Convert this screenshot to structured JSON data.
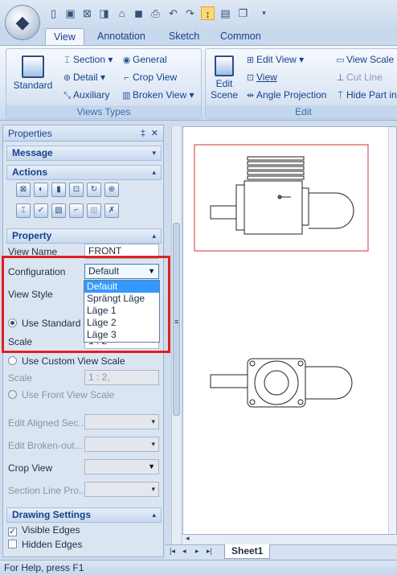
{
  "qat": {
    "icons": [
      "new-icon",
      "open-icon",
      "export-icon",
      "print-preview-icon",
      "folder-icon",
      "save-icon",
      "print-icon",
      "undo-icon",
      "redo-icon",
      "smart-dimension-icon",
      "notes-icon",
      "window-icon",
      "customize-icon"
    ]
  },
  "tabs": [
    {
      "label": "View",
      "active": true
    },
    {
      "label": "Annotation"
    },
    {
      "label": "Sketch"
    },
    {
      "label": "Common"
    }
  ],
  "ribbon": {
    "views_types": {
      "label": "Views Types",
      "standard": "Standard",
      "section": "Section",
      "detail": "Detail",
      "auxiliary": "Auxiliary",
      "general": "General",
      "crop_view": "Crop View",
      "broken_view": "Broken View"
    },
    "edit": {
      "label": "Edit",
      "edit_scene": "Edit Scene",
      "edit_view": "Edit View",
      "view": "View",
      "angle_projection": "Angle Projection",
      "view_scale": "View Scale",
      "cut_line": "Cut Line",
      "hide_part": "Hide Part in"
    }
  },
  "panel": {
    "title": "Properties",
    "pin": "‡",
    "close": "✕",
    "sections": {
      "message": "Message",
      "actions": "Actions",
      "property": "Property",
      "drawing_settings": "Drawing Settings"
    },
    "view_name_label": "View Name",
    "view_name_value": "FRONT",
    "configuration_label": "Configuration",
    "configuration_value": "Default",
    "configuration_options": [
      "Default",
      "Sprängt Läge",
      "Läge 1",
      "Läge 2",
      "Läge 3"
    ],
    "view_style_label": "View Style",
    "use_standard_label": "Use Standard V",
    "scale_label": "Scale",
    "scale_value": "1 : 2",
    "use_custom_label": "Use Custom View Scale",
    "scale2_label": "Scale",
    "scale2_value": "1 : 2,",
    "use_front_label": "Use Front View Scale",
    "edit_aligned_label": "Edit Aligned Sec...",
    "edit_broken_label": "Edit Broken-out...",
    "crop_view_label": "Crop View",
    "section_line_label": "Section Line Pro...",
    "visible_edges_label": "Visible Edges",
    "hidden_edges_label": "Hidden Edges"
  },
  "sheet": {
    "tab": "Sheet1"
  },
  "status": {
    "text": "For Help, press F1"
  },
  "colors": {
    "highlight": "#e02020",
    "selection": "#3399ff"
  }
}
